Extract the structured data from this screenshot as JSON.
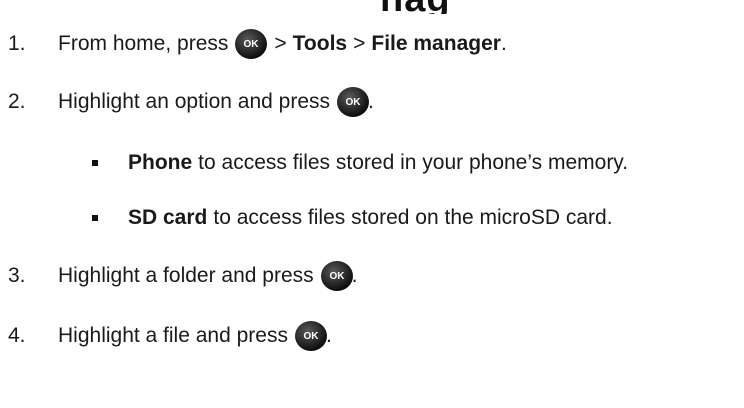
{
  "header": {
    "cutoff_title": "nag"
  },
  "steps": [
    {
      "num": "1.",
      "pre": "From home, press",
      "sep1": ">",
      "bold1": "Tools",
      "sep2": ">",
      "bold2": "File manager",
      "end": "."
    },
    {
      "num": "2.",
      "pre": "Highlight an option and press",
      "end": "."
    },
    {
      "num": "3.",
      "pre": "Highlight a folder and press",
      "end": "."
    },
    {
      "num": "4.",
      "pre": "Highlight a file and press",
      "end": "."
    }
  ],
  "options": [
    {
      "bold": "Phone",
      "text": "to access files stored in your phone’s memory."
    },
    {
      "bold": "SD card",
      "text": "to access files stored on the microSD card."
    }
  ],
  "ok_icon": {
    "name": "ok-key-icon",
    "label": "OK",
    "color": "#1c1c1c"
  }
}
